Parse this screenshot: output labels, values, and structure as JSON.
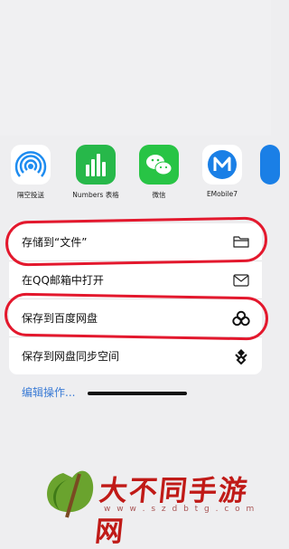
{
  "share_apps": [
    {
      "label": "隔空投送",
      "icon": "airdrop-icon"
    },
    {
      "label": "Numbers 表格",
      "icon": "numbers-icon"
    },
    {
      "label": "微信",
      "icon": "wechat-icon"
    },
    {
      "label": "EMobile7",
      "icon": "emobile-icon"
    }
  ],
  "actions": [
    {
      "label": "存储到“文件”",
      "icon": "folder-icon"
    },
    {
      "label": "在QQ邮箱中打开",
      "icon": "mail-icon"
    },
    {
      "label": "保存到百度网盘",
      "icon": "baidu-netdisk-icon"
    },
    {
      "label": "保存到网盘同步空间",
      "icon": "sync-space-icon"
    }
  ],
  "edit_actions_label": "编辑操作...",
  "watermark": {
    "text": "大不同手游网",
    "url": "w w w . s z d b t g . c o m"
  },
  "colors": {
    "annotation_red": "#e3182d",
    "link_blue": "#3a7bd5"
  }
}
